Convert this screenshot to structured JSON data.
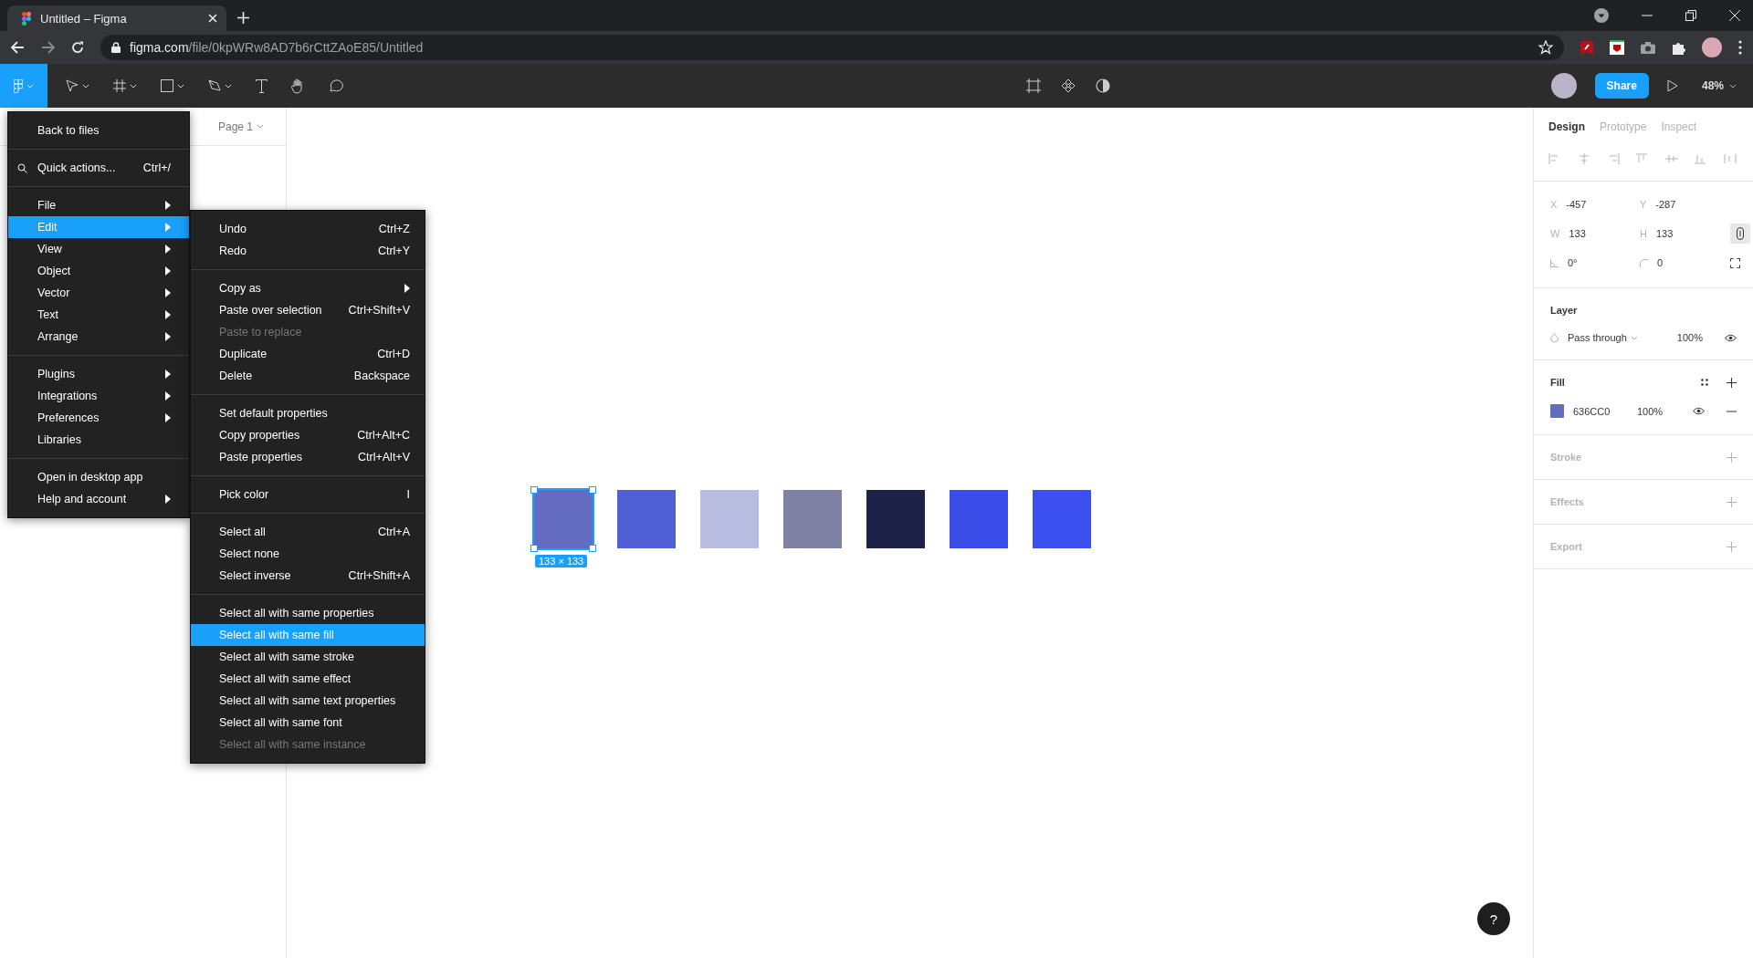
{
  "browser": {
    "tab": {
      "title": "Untitled – Figma"
    },
    "url": {
      "host": "figma.com",
      "path": "/file/0kpWRw8AD7b6rCttZAoE85/Untitled"
    }
  },
  "toolbar": {
    "share": "Share",
    "zoom": "48%"
  },
  "left_panel": {
    "page": "Page 1"
  },
  "main_menu": {
    "groups": [
      {
        "items": [
          {
            "label": "Back to files",
            "selected": false
          }
        ]
      },
      {
        "items": [
          {
            "kind": "search",
            "label": "Quick actions...",
            "shortcut": "Ctrl+/",
            "selected": false
          }
        ]
      },
      {
        "items": [
          {
            "label": "File",
            "submenu": true,
            "selected": false
          },
          {
            "label": "Edit",
            "submenu": true,
            "selected": true
          },
          {
            "label": "View",
            "submenu": true,
            "selected": false
          },
          {
            "label": "Object",
            "submenu": true,
            "selected": false
          },
          {
            "label": "Vector",
            "submenu": true,
            "selected": false
          },
          {
            "label": "Text",
            "submenu": true,
            "selected": false
          },
          {
            "label": "Arrange",
            "submenu": true,
            "selected": false
          }
        ]
      },
      {
        "items": [
          {
            "label": "Plugins",
            "submenu": true,
            "selected": false
          },
          {
            "label": "Integrations",
            "submenu": true,
            "selected": false
          },
          {
            "label": "Preferences",
            "submenu": true,
            "selected": false
          },
          {
            "label": "Libraries",
            "selected": false
          }
        ]
      },
      {
        "items": [
          {
            "label": "Open in desktop app",
            "selected": false
          },
          {
            "label": "Help and account",
            "submenu": true,
            "selected": false
          }
        ]
      }
    ]
  },
  "edit_menu": {
    "groups": [
      {
        "items": [
          {
            "label": "Undo",
            "shortcut": "Ctrl+Z",
            "selected": false,
            "disabled": false
          },
          {
            "label": "Redo",
            "shortcut": "Ctrl+Y",
            "selected": false,
            "disabled": false
          }
        ]
      },
      {
        "items": [
          {
            "label": "Copy as",
            "submenu": true,
            "selected": false,
            "disabled": false
          },
          {
            "label": "Paste over selection",
            "shortcut": "Ctrl+Shift+V",
            "selected": false,
            "disabled": false
          },
          {
            "label": "Paste to replace",
            "selected": false,
            "disabled": true
          },
          {
            "label": "Duplicate",
            "shortcut": "Ctrl+D",
            "selected": false,
            "disabled": false
          },
          {
            "label": "Delete",
            "shortcut": "Backspace",
            "selected": false,
            "disabled": false
          }
        ]
      },
      {
        "items": [
          {
            "label": "Set default properties",
            "selected": false,
            "disabled": false
          },
          {
            "label": "Copy properties",
            "shortcut": "Ctrl+Alt+C",
            "selected": false,
            "disabled": false
          },
          {
            "label": "Paste properties",
            "shortcut": "Ctrl+Alt+V",
            "selected": false,
            "disabled": false
          }
        ]
      },
      {
        "items": [
          {
            "label": "Pick color",
            "shortcut": "I",
            "selected": false,
            "disabled": false
          }
        ]
      },
      {
        "items": [
          {
            "label": "Select all",
            "shortcut": "Ctrl+A",
            "selected": false,
            "disabled": false
          },
          {
            "label": "Select none",
            "selected": false,
            "disabled": false
          },
          {
            "label": "Select inverse",
            "shortcut": "Ctrl+Shift+A",
            "selected": false,
            "disabled": false
          }
        ]
      },
      {
        "items": [
          {
            "label": "Select all with same properties",
            "selected": false,
            "disabled": false
          },
          {
            "label": "Select all with same fill",
            "selected": true,
            "disabled": false
          },
          {
            "label": "Select all with same stroke",
            "selected": false,
            "disabled": false
          },
          {
            "label": "Select all with same effect",
            "selected": false,
            "disabled": false
          },
          {
            "label": "Select all with same text properties",
            "selected": false,
            "disabled": false
          },
          {
            "label": "Select all with same font",
            "selected": false,
            "disabled": false
          },
          {
            "label": "Select all with same instance",
            "selected": false,
            "disabled": true
          }
        ]
      }
    ]
  },
  "canvas": {
    "size_label": "133 × 133",
    "squares": [
      {
        "color": "#636cc0",
        "selected": true
      },
      {
        "color": "#5060d4",
        "selected": false
      },
      {
        "color": "#b7bce0",
        "selected": false
      },
      {
        "color": "#7e80a4",
        "selected": false
      },
      {
        "color": "#1e2248",
        "selected": false
      },
      {
        "color": "#3a4ce8",
        "selected": false
      },
      {
        "color": "#3c50f0",
        "selected": false
      }
    ]
  },
  "right_panel": {
    "tabs": [
      {
        "label": "Design",
        "selected": true
      },
      {
        "label": "Prototype",
        "selected": false
      },
      {
        "label": "Inspect",
        "selected": false
      }
    ],
    "x": {
      "label": "X",
      "value": "-457"
    },
    "y": {
      "label": "Y",
      "value": "-287"
    },
    "w": {
      "label": "W",
      "value": "133"
    },
    "h": {
      "label": "H",
      "value": "133"
    },
    "rotation": "0°",
    "radius": "0",
    "layer": {
      "title": "Layer",
      "blend": "Pass through",
      "opacity": "100%"
    },
    "fill": {
      "title": "Fill",
      "color": "#636cc0",
      "hex": "636CC0",
      "opacity": "100%"
    },
    "sections": [
      "Stroke",
      "Effects",
      "Export"
    ]
  },
  "help": "?"
}
